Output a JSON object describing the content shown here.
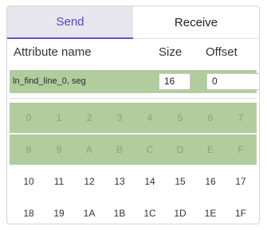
{
  "tabs": [
    {
      "label": "Send",
      "active": true
    },
    {
      "label": "Receive",
      "active": false
    }
  ],
  "header": {
    "attribute": "Attribute name",
    "size": "Size",
    "offset": "Offset"
  },
  "attribute_row": {
    "name": "ln_find_line_0, seg",
    "size": "16",
    "offset": "0"
  },
  "grid": {
    "rows": [
      [
        "0",
        "1",
        "2",
        "3",
        "4",
        "5",
        "6",
        "7"
      ],
      [
        "8",
        "9",
        "A",
        "B",
        "C",
        "D",
        "E",
        "F"
      ],
      [
        "10",
        "11",
        "12",
        "13",
        "14",
        "15",
        "16",
        "17"
      ],
      [
        "18",
        "19",
        "1A",
        "1B",
        "1C",
        "1D",
        "1E",
        "1F"
      ]
    ],
    "highlighted_rows": [
      0,
      1
    ]
  },
  "colors": {
    "accent": "#6a52c4",
    "highlight": "#b1cc9d",
    "active_tab_bg": "#e7e6ee"
  }
}
